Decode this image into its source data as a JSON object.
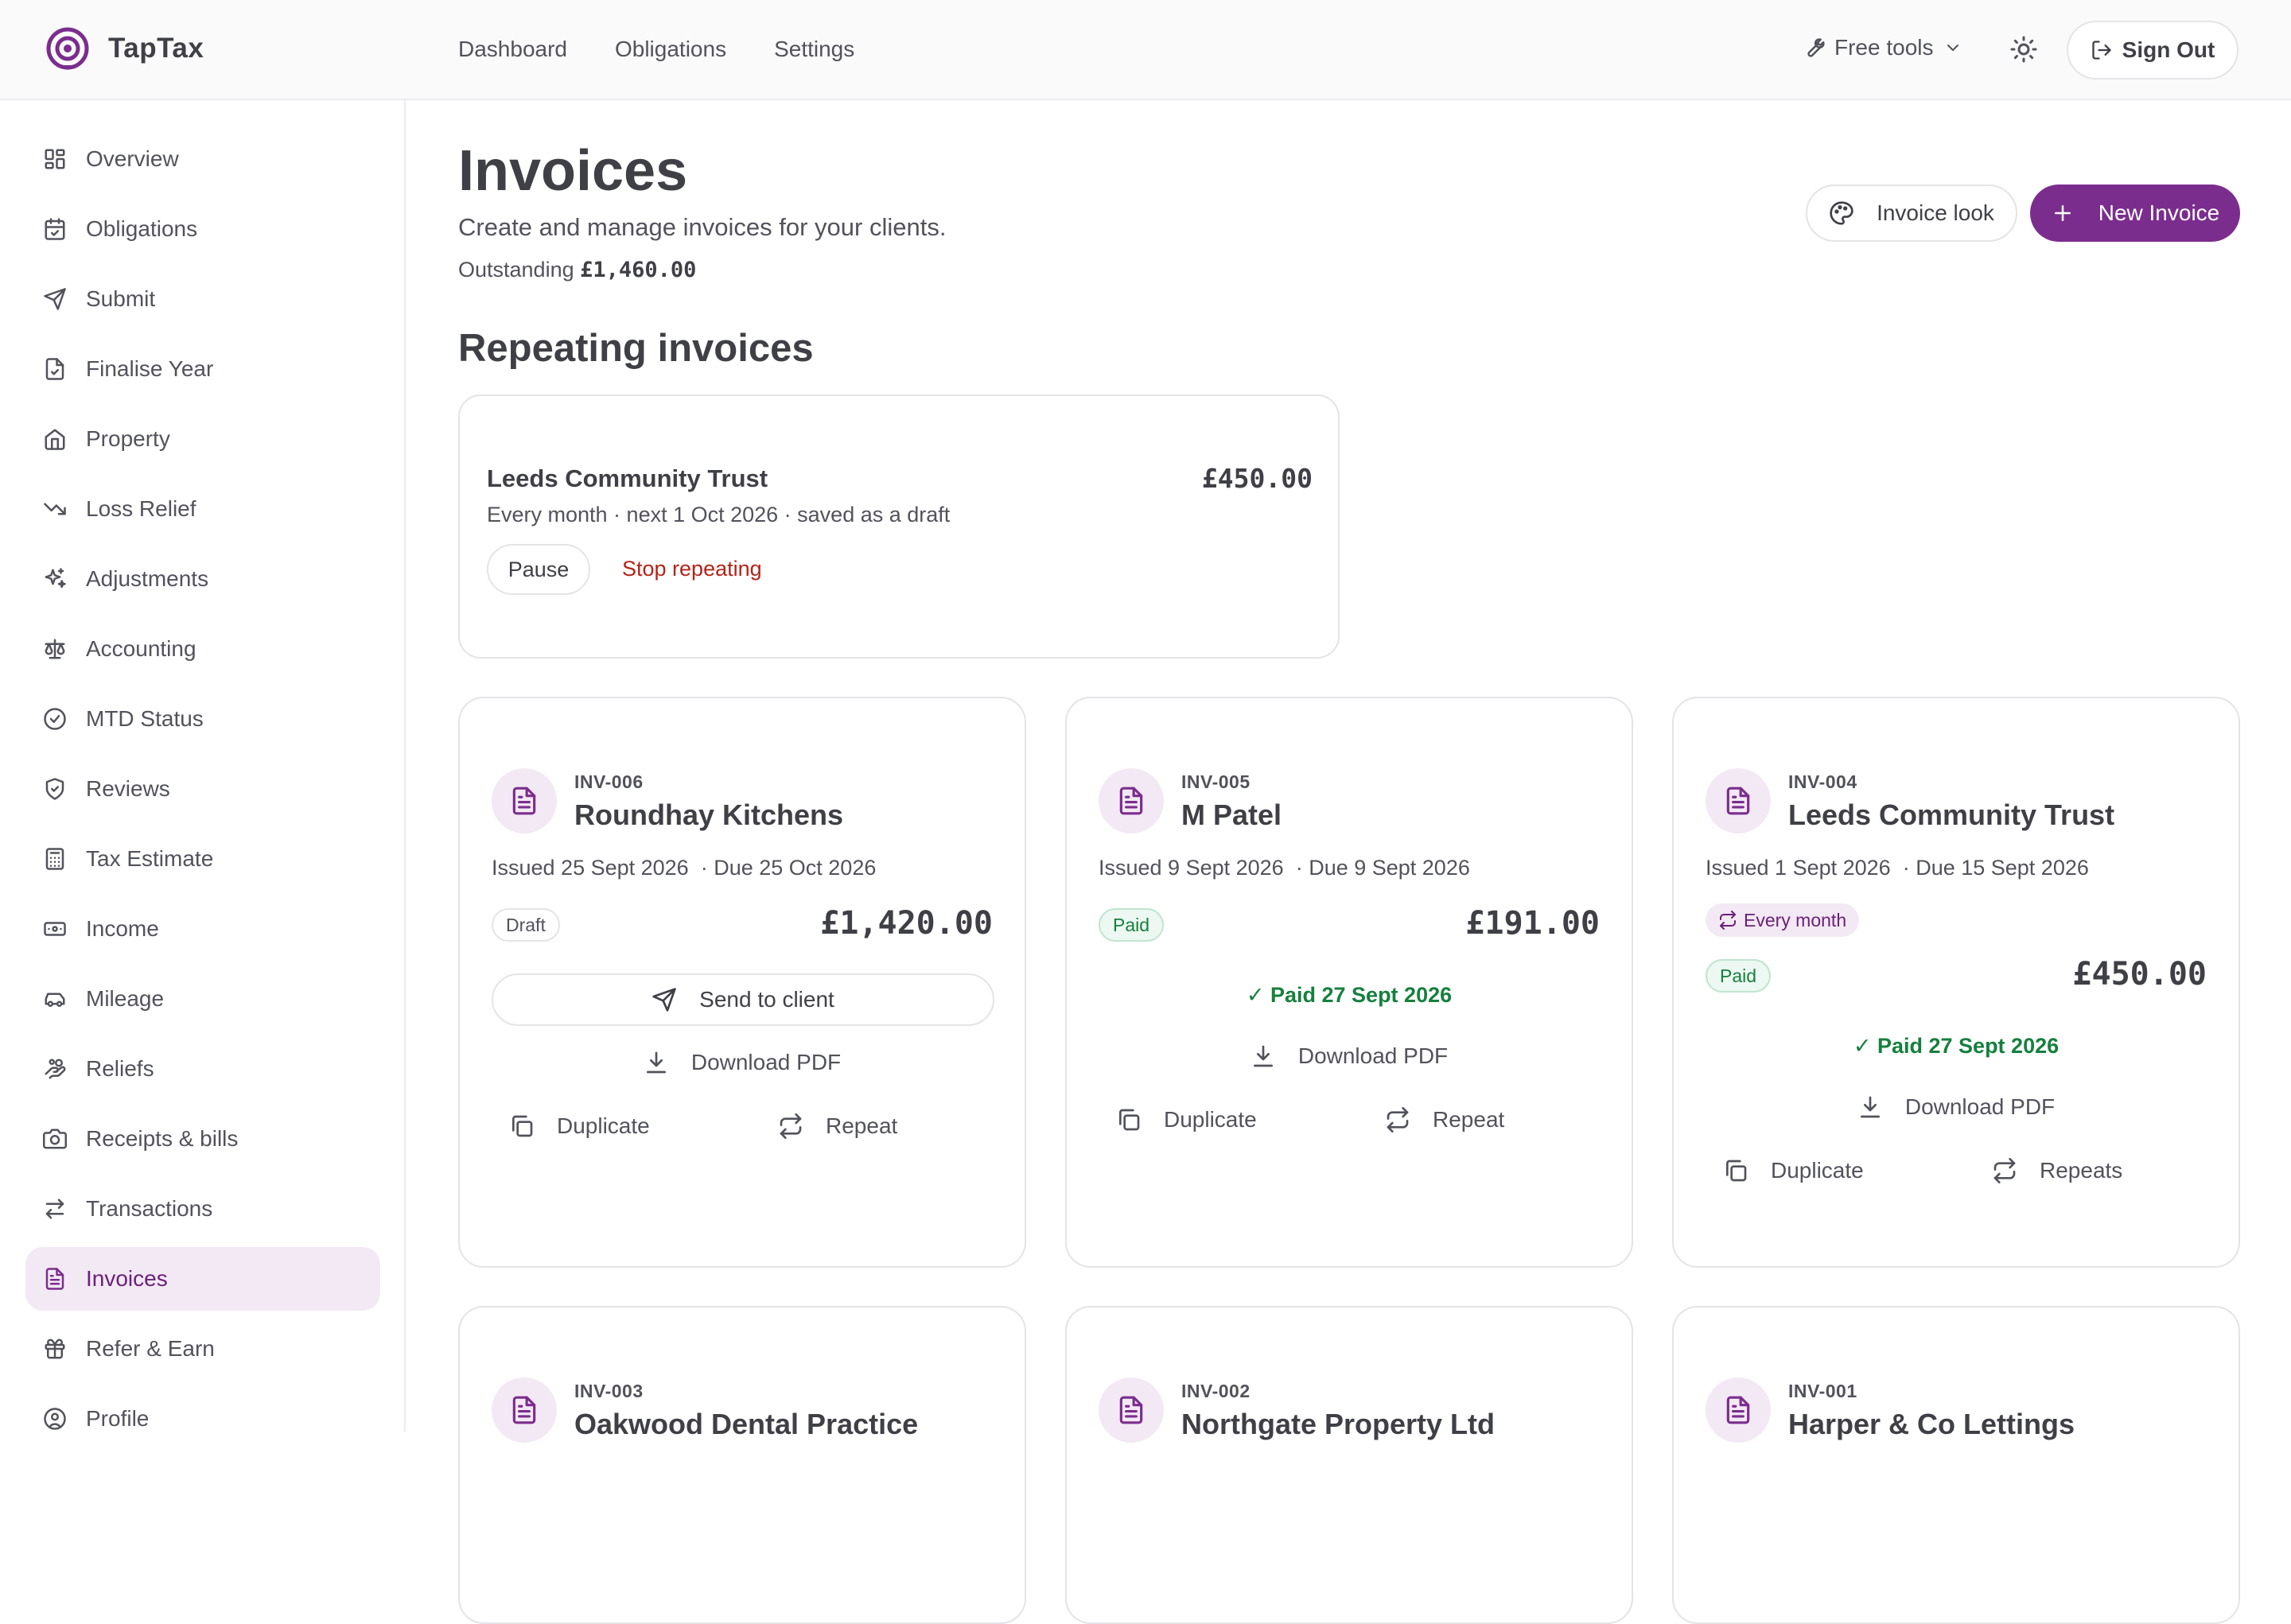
{
  "brand": {
    "name": "TapTax"
  },
  "topnav": {
    "items": [
      "Dashboard",
      "Obligations",
      "Settings"
    ],
    "tools_label": "Free tools",
    "signout_label": "Sign Out"
  },
  "sidebar": {
    "active": "Invoices",
    "items": [
      {
        "label": "Overview",
        "icon": "grid-icon"
      },
      {
        "label": "Obligations",
        "icon": "calendar-check-icon"
      },
      {
        "label": "Submit",
        "icon": "send-icon"
      },
      {
        "label": "Finalise Year",
        "icon": "file-check-icon"
      },
      {
        "label": "Property",
        "icon": "home-icon"
      },
      {
        "label": "Loss Relief",
        "icon": "trending-down-icon"
      },
      {
        "label": "Adjustments",
        "icon": "sparkles-icon"
      },
      {
        "label": "Accounting",
        "icon": "scale-icon"
      },
      {
        "label": "MTD Status",
        "icon": "check-circle-icon"
      },
      {
        "label": "Reviews",
        "icon": "shield-check-icon"
      },
      {
        "label": "Tax Estimate",
        "icon": "calculator-icon"
      },
      {
        "label": "Income",
        "icon": "banknote-icon"
      },
      {
        "label": "Mileage",
        "icon": "car-icon"
      },
      {
        "label": "Reliefs",
        "icon": "hand-coins-icon"
      },
      {
        "label": "Receipts & bills",
        "icon": "camera-icon"
      },
      {
        "label": "Transactions",
        "icon": "arrows-swap-icon"
      },
      {
        "label": "Invoices",
        "icon": "file-text-icon"
      },
      {
        "label": "Refer & Earn",
        "icon": "gift-icon"
      },
      {
        "label": "Profile",
        "icon": "user-circle-icon"
      }
    ]
  },
  "page": {
    "title": "Invoices",
    "subtitle": "Create and manage invoices for your clients.",
    "outstanding_label": "Outstanding",
    "outstanding_value": "£1,460.00",
    "invoice_look_label": "Invoice look",
    "new_invoice_label": "New Invoice",
    "repeating_heading": "Repeating invoices"
  },
  "repeating": {
    "client": "Leeds Community Trust",
    "amount": "£450.00",
    "meta": "Every month · next 1 Oct 2026 · saved as a draft",
    "pause_label": "Pause",
    "stop_label": "Stop repeating"
  },
  "invoices": [
    {
      "number": "INV-006",
      "client": "Roundhay Kitchens",
      "issued": "Issued 25 Sept 2026",
      "due": "· Due 25 Oct 2026",
      "status": "Draft",
      "amount": "£1,420.00",
      "send_label": "Send to client",
      "download_label": "Download PDF",
      "duplicate_label": "Duplicate",
      "repeat_label": "Repeat"
    },
    {
      "number": "INV-005",
      "client": "M Patel",
      "issued": "Issued 9 Sept 2026",
      "due": "· Due 9 Sept 2026",
      "status": "Paid",
      "amount": "£191.00",
      "paid_label": "✓ Paid 27 Sept 2026",
      "download_label": "Download PDF",
      "duplicate_label": "Duplicate",
      "repeat_label": "Repeat"
    },
    {
      "number": "INV-004",
      "client": "Leeds Community Trust",
      "issued": "Issued 1 Sept 2026",
      "due": "· Due 15 Sept 2026",
      "frequency": "Every month",
      "status": "Paid",
      "amount": "£450.00",
      "paid_label": "✓ Paid 27 Sept 2026",
      "download_label": "Download PDF",
      "duplicate_label": "Duplicate",
      "repeat_label": "Repeats"
    },
    {
      "number": "INV-003",
      "client": "Oakwood Dental Practice"
    },
    {
      "number": "INV-002",
      "client": "Northgate Property Ltd"
    },
    {
      "number": "INV-001",
      "client": "Harper & Co Lettings"
    }
  ],
  "colors": {
    "accent": "#7b2d8e",
    "paid_green": "#15803d",
    "danger": "#b42318",
    "active_bg": "#f3e9f4"
  }
}
